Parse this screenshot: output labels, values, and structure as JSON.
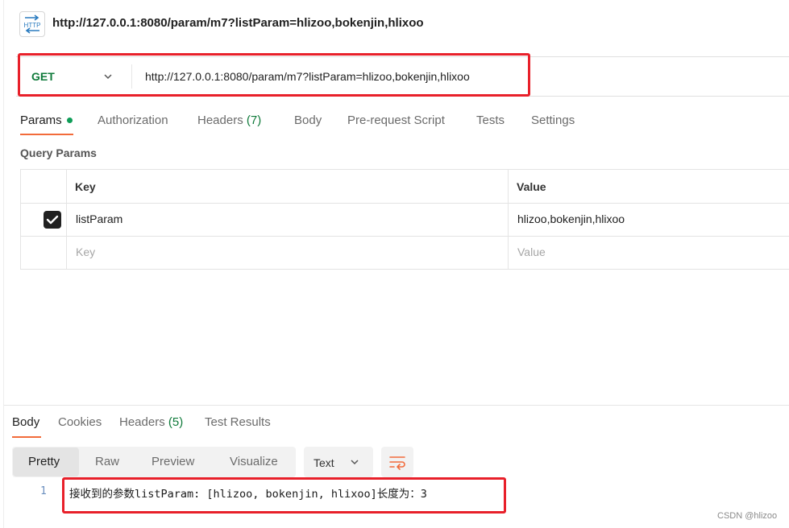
{
  "request": {
    "title": "http://127.0.0.1:8080/param/m7?listParam=hlizoo,bokenjin,hlixoo",
    "icon_text": "HTTP",
    "method": "GET",
    "url": "http://127.0.0.1:8080/param/m7?listParam=hlizoo,bokenjin,hlixoo"
  },
  "request_tabs": [
    {
      "label": "Params",
      "count": "",
      "active": true
    },
    {
      "label": "Authorization",
      "count": ""
    },
    {
      "label": "Headers",
      "count": "(7)"
    },
    {
      "label": "Body",
      "count": ""
    },
    {
      "label": "Pre-request Script",
      "count": ""
    },
    {
      "label": "Tests",
      "count": ""
    },
    {
      "label": "Settings",
      "count": ""
    }
  ],
  "query_params": {
    "section_label": "Query Params",
    "headers": {
      "key": "Key",
      "value": "Value"
    },
    "rows": [
      {
        "checked": true,
        "key": "listParam",
        "value": "hlizoo,bokenjin,hlixoo"
      }
    ],
    "placeholder": {
      "key": "Key",
      "value": "Value"
    }
  },
  "response_tabs": [
    {
      "label": "Body",
      "count": "",
      "active": true
    },
    {
      "label": "Cookies",
      "count": ""
    },
    {
      "label": "Headers",
      "count": "(5)"
    },
    {
      "label": "Test Results",
      "count": ""
    }
  ],
  "view_modes": [
    "Pretty",
    "Raw",
    "Preview",
    "Visualize"
  ],
  "active_view_mode": "Pretty",
  "format": "Text",
  "response": {
    "line_number": "1",
    "text": "接收到的参数listParam: [hlizoo, bokenjin, hlixoo]长度为：3"
  },
  "watermark": "CSDN @hlizoo",
  "colors": {
    "accent": "#f26b3a",
    "method_green": "#0f7a3a",
    "annotation_red": "#e8202a"
  }
}
